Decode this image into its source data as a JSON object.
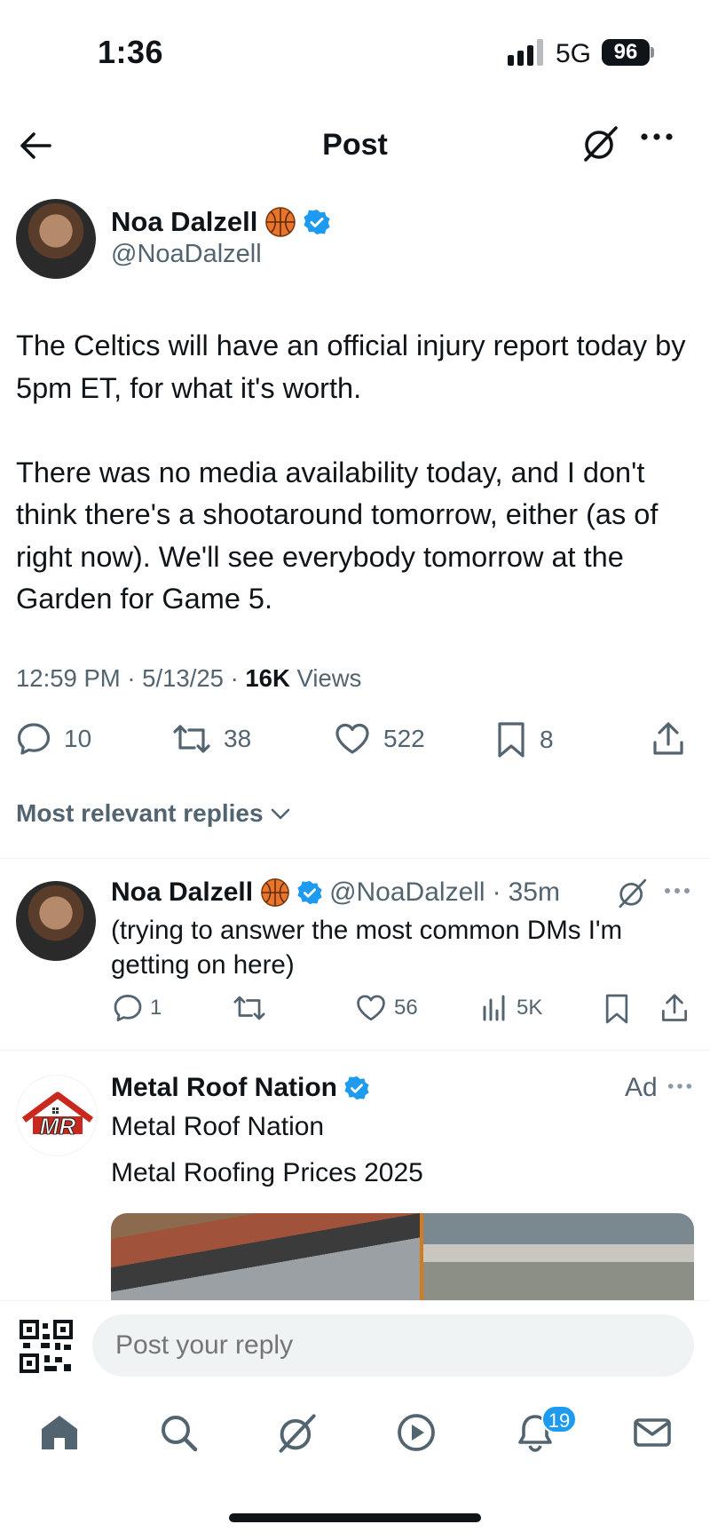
{
  "status_bar": {
    "time": "1:36",
    "network": "5G",
    "battery": "96"
  },
  "header": {
    "title": "Post"
  },
  "post": {
    "author_name": "Noa Dalzell",
    "author_handle": "@NoaDalzell",
    "body": "The Celtics will have an official injury report today by 5pm ET, for what it's worth.\n\nThere was no media availability today, and I don't think there's a shootaround tomorrow, either (as of right now). We'll see everybody tomorrow at the Garden for Game 5.",
    "time": "12:59 PM",
    "date": "5/13/25",
    "views_count": "16K",
    "views_label": "Views",
    "replies": "10",
    "reposts": "38",
    "likes": "522",
    "bookmarks": "8"
  },
  "replies_filter": {
    "label": "Most relevant replies"
  },
  "reply": {
    "author_name": "Noa Dalzell",
    "author_handle": "@NoaDalzell",
    "age": "35m",
    "body": "(trying to answer the most common DMs I'm getting on here)",
    "replies": "1",
    "likes": "56",
    "views": "5K"
  },
  "ad": {
    "advertiser": "Metal Roof Nation",
    "label": "Ad",
    "subtitle": "Metal Roof Nation",
    "headline": "Metal Roofing Prices 2025",
    "logo_text": "MR"
  },
  "composer": {
    "placeholder": "Post your reply"
  },
  "tabbar": {
    "notifications_badge": "19"
  },
  "colors": {
    "accent": "#1d9bf0",
    "text": "#0f1419",
    "secondary": "#536471",
    "divider": "#eff3f4"
  },
  "icons": [
    "back-arrow-icon",
    "grok-icon",
    "more-icon",
    "basketball-emoji-icon",
    "verified-badge-icon",
    "reply-icon",
    "repost-icon",
    "like-icon",
    "bookmark-icon",
    "share-icon",
    "views-icon",
    "chevron-down-icon",
    "qr-code-icon",
    "home-icon",
    "search-icon",
    "play-icon",
    "bell-icon",
    "mail-icon"
  ]
}
